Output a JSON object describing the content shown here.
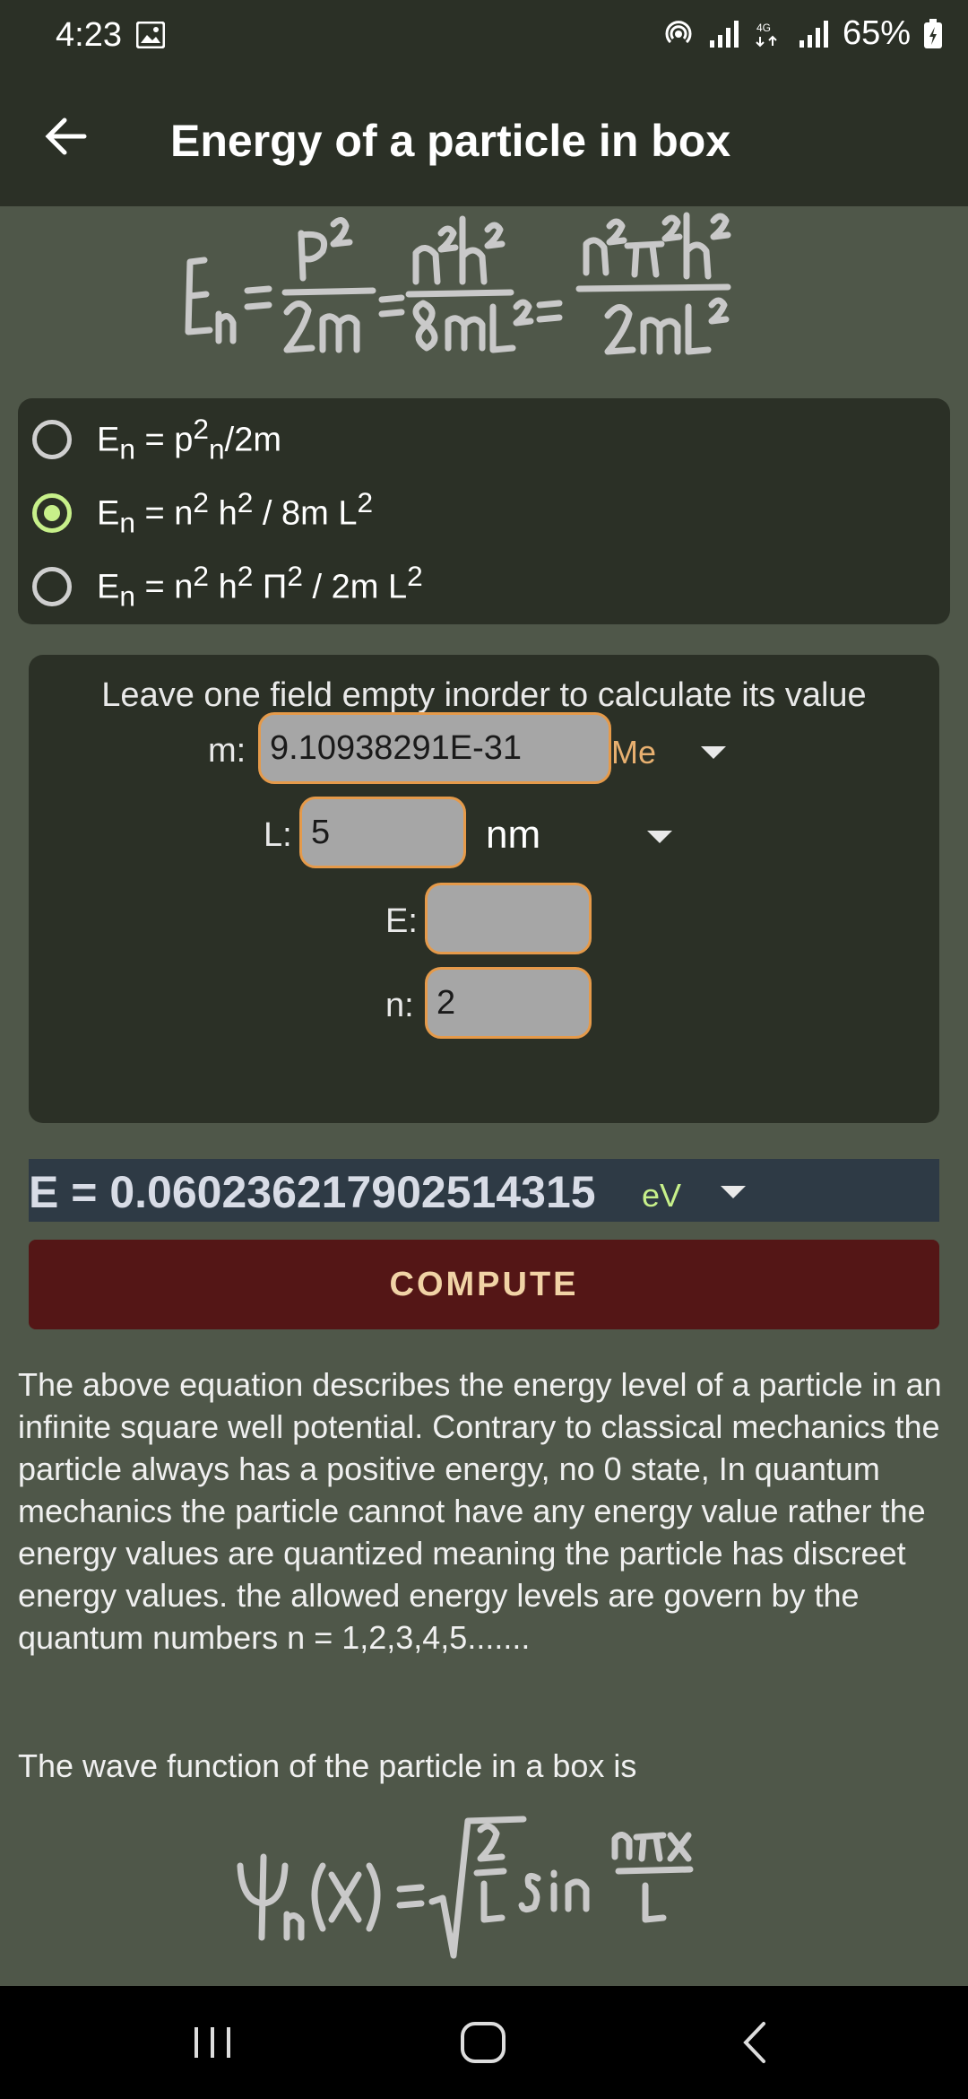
{
  "status": {
    "time": "4:23",
    "battery": "65%"
  },
  "appbar": {
    "title": "Energy of a particle in box"
  },
  "radio_options": {
    "opt1": {
      "main": "E",
      "sub": "n",
      "rest_a": " = p",
      "sup": "2",
      "sub2": "n",
      "rest_b": "/2m"
    },
    "opt2": {
      "main": "E",
      "sub": "n",
      "rest_a": " = n",
      "sup": "2",
      "rest_b": " h",
      "sup2": "2",
      "rest_c": " / 8m L",
      "sup3": "2"
    },
    "opt3": {
      "main": "E",
      "sub": "n",
      "rest_a": " = n",
      "sup": "2",
      "rest_b": " h",
      "sup2": "2",
      "rest_c": " Π",
      "sup3": "2",
      "rest_d": " / 2m L",
      "sup4": "2"
    }
  },
  "calc": {
    "hint": "Leave one field empty inorder to calculate its value",
    "m_label": "m:",
    "m_value": "9.10938291E-31",
    "m_unit": "Me",
    "L_label": "L:",
    "L_value": "5",
    "L_unit": "nm",
    "E_label": "E:",
    "E_value": "",
    "n_label": "n:",
    "n_value": "2"
  },
  "result": {
    "text": "E = 0.060236217902514315",
    "unit": "eV"
  },
  "compute_label": "COMPUTE",
  "description": "The above equation describes the energy level of a particle in an infinite square well potential. Contrary to classical mechanics the particle always has a positive energy, no 0 state, In quantum mechanics the particle cannot have any energy value rather the energy values are quantized meaning the particle has discreet energy values. the allowed energy levels are govern by the quantum numbers n = 1,2,3,4,5.......",
  "wave_title": "The wave function of the particle in a box is",
  "colors": {
    "accent": "#c7f08a",
    "input_border": "#e59a4a",
    "compute_bg": "#541616",
    "formula_ink": "#c9c9c9"
  },
  "icons": {
    "back": "arrow-left-icon",
    "gallery": "image-icon",
    "hotspot": "hotspot-icon",
    "signal": "signal-icon",
    "battery": "battery-icon",
    "dropdown": "chevron-down-icon",
    "nav_recent": "recent-apps-icon",
    "nav_home": "home-icon",
    "nav_back": "back-icon"
  }
}
